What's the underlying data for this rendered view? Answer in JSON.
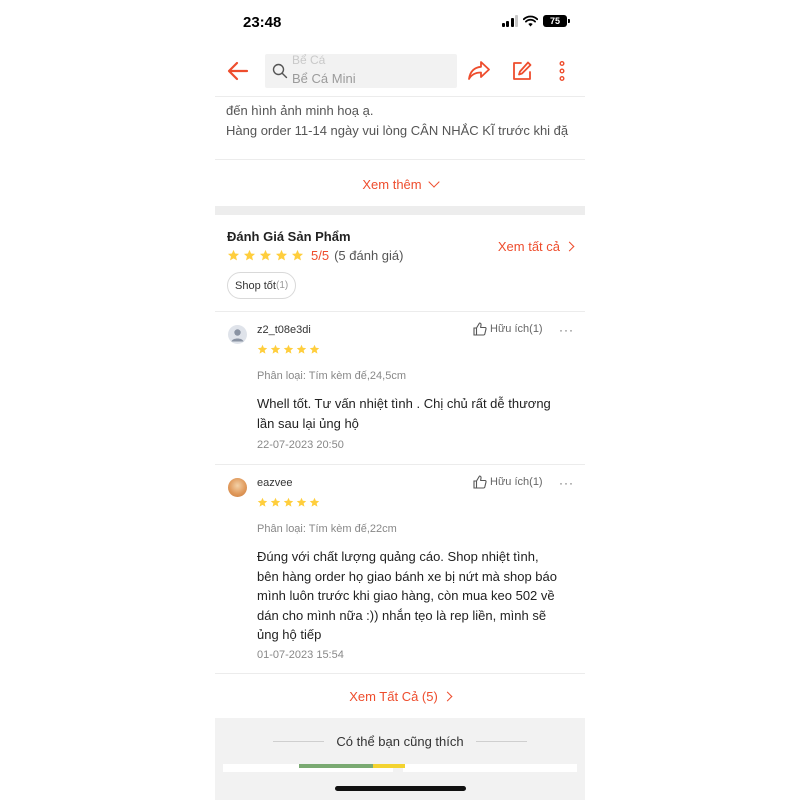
{
  "status_bar": {
    "time": "23:48",
    "battery": "75"
  },
  "top_nav": {
    "search_prev_keyword": "Bể Cá",
    "search_keyword": "Bể Cá Mini",
    "icons": [
      "back-arrow-icon",
      "search-icon",
      "share-icon",
      "edit-icon",
      "more-vertical-icon"
    ]
  },
  "description": {
    "line1": "đến hình ảnh minh hoạ ạ.",
    "line2": "Hàng order 11-14 ngày vui lòng CÂN NHẮC KĨ trước khi đặ",
    "see_more": "Xem thêm"
  },
  "ratings": {
    "title": "Đánh Giá Sản Phẩm",
    "stars": 5,
    "score": "5/5",
    "count": "(5 đánh giá)",
    "see_all": "Xem tất cả",
    "tag_label": "Shop tốt",
    "tag_count": "(1)"
  },
  "reviews": [
    {
      "username": "z2_t08e3di",
      "helpful": "Hữu ích(1)",
      "more": "···",
      "stars": 5,
      "variant": "Phân loại: Tím kèm đế,24,5cm",
      "body_lines": [
        "Whell tốt.  Tư vấn nhiệt tình . Chị chủ rất dễ thương",
        "lần sau lại ủng hộ"
      ],
      "date": "22-07-2023 20:50"
    },
    {
      "username": "eazvee",
      "helpful": "Hữu ích(1)",
      "more": "···",
      "stars": 5,
      "variant": "Phân loại: Tím kèm đế,22cm",
      "body_lines": [
        "Đúng với chất lượng quảng cáo. Shop nhiệt tình,",
        "bên hàng order họ giao bánh xe bị nứt mà shop báo",
        "mình luôn trước khi giao hàng, còn mua keo 502 về",
        "dán cho mình nữa :)) nhắn tẹo là rep liền, mình sẽ",
        "ủng hộ tiếp"
      ],
      "date": "01-07-2023 15:54"
    }
  ],
  "see_all_bottom": "Xem Tất Cả (5)",
  "recommend": {
    "title": "Có thể bạn cũng thích"
  },
  "colors": {
    "accent": "#ee4d2d",
    "star": "#ffce3d",
    "separator": "#ededed"
  }
}
